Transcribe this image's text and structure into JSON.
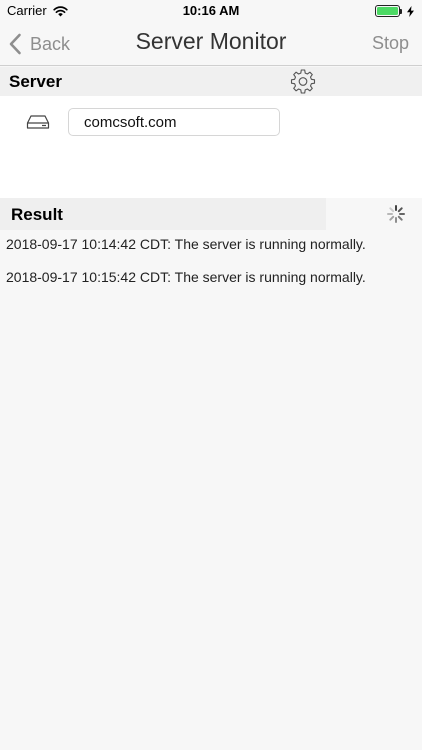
{
  "status_bar": {
    "carrier": "Carrier",
    "time": "10:16 AM",
    "battery_level": 1.0,
    "battery_color": "#4cd964"
  },
  "nav": {
    "back_label": "Back",
    "title": "Server Monitor",
    "stop_label": "Stop"
  },
  "server_section": {
    "header": "Server",
    "settings_icon": "gear-icon",
    "server_icon": "drive-icon",
    "server_value": "comcsoft.com"
  },
  "result_section": {
    "header": "Result",
    "activity_icon": "spinner-icon",
    "lines": [
      "2018-09-17 10:14:42 CDT: The server is running normally.",
      "2018-09-17 10:15:42 CDT: The server is running normally."
    ]
  }
}
